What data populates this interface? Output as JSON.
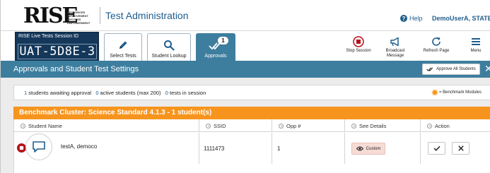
{
  "header": {
    "logo_text": "RISE",
    "logo_tagline": "Resources Improvement Success Empowerment",
    "app_title": "Test Administration",
    "help_label": "Help",
    "user_label": "DemoUserA, STATE"
  },
  "session": {
    "label": "RISE Live Tests  Session ID",
    "id": "UAT-5D8E-3"
  },
  "toolbar": {
    "select_tests": "Select Tests",
    "student_lookup": "Student Lookup",
    "approvals": "Approvals",
    "approvals_count": "1",
    "stop_session": "Stop Session",
    "broadcast_message": "Broadcast Message",
    "refresh_page": "Refresh Page",
    "menu": "Menu"
  },
  "panel": {
    "title": "Approvals and Student Test Settings",
    "approve_all": "Approve All Students",
    "close": "✕"
  },
  "summary": {
    "awaiting_count": "1",
    "awaiting_text": " students awaiting approval",
    "active_count": "0",
    "active_text": " active students (max 200)",
    "tests_count": "0",
    "tests_text": " tests in session",
    "legend": "= Benchmark Modules"
  },
  "cluster": {
    "title": "Benchmark Cluster: Science Standard 4.1.3 -  1  student(s)"
  },
  "table": {
    "columns": [
      "Student Name",
      "SSID",
      "Opp #",
      "See Details",
      "Action"
    ],
    "rows": [
      {
        "name": "testA, democo",
        "ssid": "1111473",
        "opp": "1",
        "details_label": "Custom"
      }
    ]
  },
  "colors": {
    "teal": "#3d7e9e",
    "navy": "#14375a",
    "orange": "#f7941d",
    "link_blue": "#1f5e8e",
    "stop_red": "#b5121b"
  }
}
